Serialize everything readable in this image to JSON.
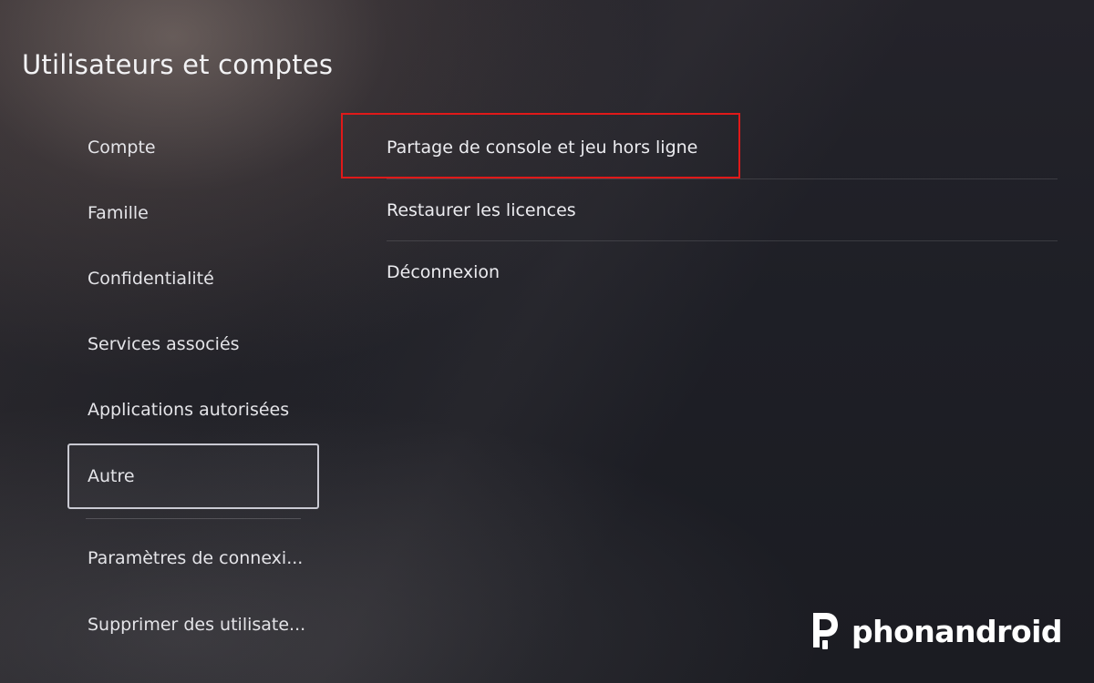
{
  "header": {
    "title": "Utilisateurs et comptes"
  },
  "sidebar": {
    "items": [
      {
        "label": "Compte"
      },
      {
        "label": "Famille"
      },
      {
        "label": "Confidentialité"
      },
      {
        "label": "Services associés"
      },
      {
        "label": "Applications autorisées"
      },
      {
        "label": "Autre",
        "selected": true
      },
      {
        "label": "Paramètres de connexi..."
      },
      {
        "label": "Supprimer des utilisate..."
      }
    ]
  },
  "main": {
    "items": [
      {
        "label": "Partage de console et jeu hors ligne",
        "highlighted": true
      },
      {
        "label": "Restaurer les licences"
      },
      {
        "label": "Déconnexion"
      }
    ]
  },
  "watermark": {
    "text": "phonandroid",
    "icon": "phonandroid-logo-icon"
  },
  "colors": {
    "highlight": "#e01919",
    "selection_border": "#c9c9d2",
    "text": "#e4e4e8"
  }
}
